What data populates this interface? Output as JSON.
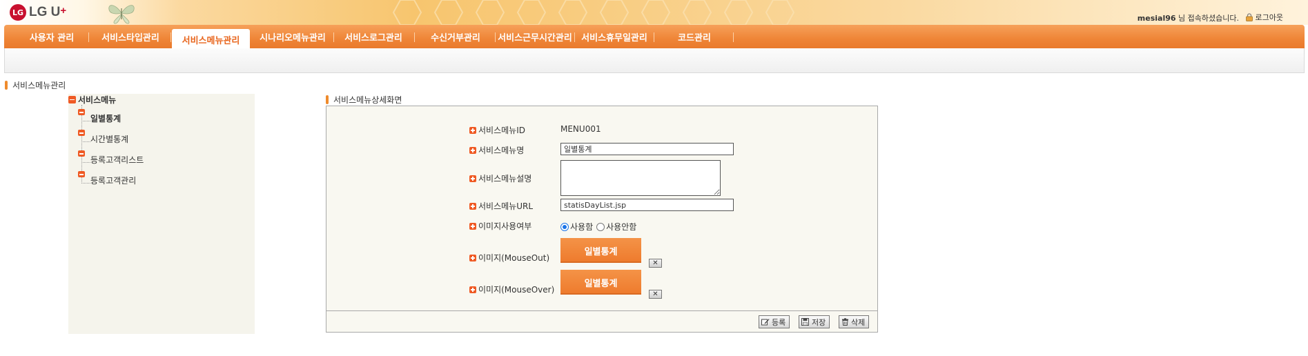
{
  "header": {
    "logo_text": "LG U",
    "logo_plus": "+",
    "logo_circle": "LG",
    "user_id": "mesial96",
    "user_suffix": " 님 접속하셨습니다.",
    "logout_label": "로그아웃"
  },
  "nav": {
    "items": [
      {
        "label": "사용자 관리"
      },
      {
        "label": "서비스타입관리"
      },
      {
        "label": "서비스메뉴관리",
        "active": true
      },
      {
        "label": "시나리오메뉴관리"
      },
      {
        "label": "서비스로그관리"
      },
      {
        "label": "수신거부관리"
      },
      {
        "label": "서비스근무시간관리"
      },
      {
        "label": "서비스휴무일관리"
      },
      {
        "label": "코드관리"
      }
    ]
  },
  "breadcrumb": "서비스메뉴관리",
  "tree": {
    "root_label": "서비스메뉴",
    "nodes": [
      {
        "label": "일별통계",
        "selected": true
      },
      {
        "label": "시간별통계"
      },
      {
        "label": "등록고객리스트"
      },
      {
        "label": "등록고객관리"
      }
    ]
  },
  "detail": {
    "title": "서비스메뉴상세화면",
    "fields": {
      "menu_id_label": "서비스메뉴ID",
      "menu_id_value": "MENU001",
      "menu_name_label": "서비스메뉴명",
      "menu_name_value": "일별통계",
      "menu_desc_label": "서비스메뉴설명",
      "menu_desc_value": "",
      "menu_url_label": "서비스메뉴URL",
      "menu_url_value": "statisDayList.jsp",
      "image_use_label": "이미지사용여부",
      "image_use_yes": "사용함",
      "image_use_no": "사용안함",
      "image_use_selected": "사용함",
      "mouseout_label": "이미지(MouseOut)",
      "mouseout_button": "일별통계",
      "mouseover_label": "이미지(MouseOver)",
      "mouseover_button": "일별통계",
      "remove_glyph": "✕"
    },
    "actions": {
      "register": "등록",
      "save": "저장",
      "delete": "삭제"
    }
  },
  "colors": {
    "nav_orange": "#ef8537",
    "active_tab_text": "#e8651c",
    "icon_red": "#ef5a24",
    "tree_bg": "#f5f4ec",
    "panel_bg": "#f9f8f1"
  }
}
